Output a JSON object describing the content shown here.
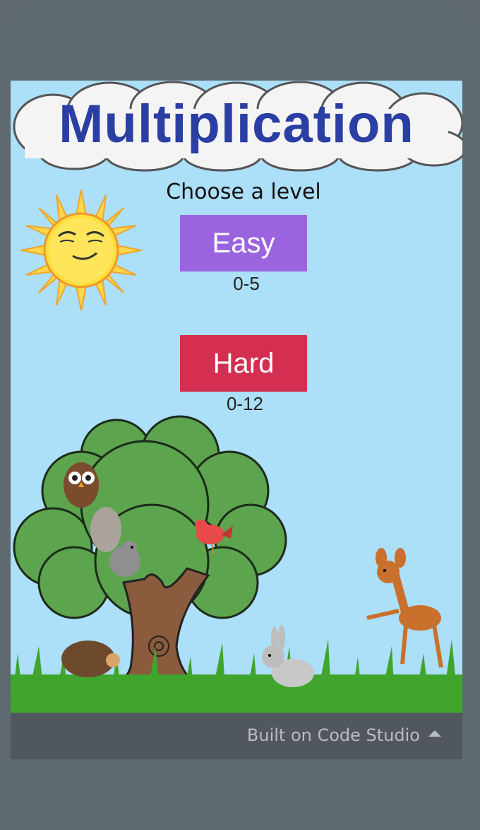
{
  "app": {
    "title": "Multiplication",
    "prompt": "Choose a level"
  },
  "levels": [
    {
      "label": "Easy",
      "range": "0-5",
      "color": "#9b64df"
    },
    {
      "label": "Hard",
      "range": "0-12",
      "color": "#d42e50"
    }
  ],
  "footer": {
    "label": "Built on Code Studio",
    "icon": "caret-up-icon"
  },
  "colors": {
    "sky": "#acdff8",
    "title": "#2a3ea3",
    "frame": "#5f6a70",
    "footer": "#50575e"
  }
}
